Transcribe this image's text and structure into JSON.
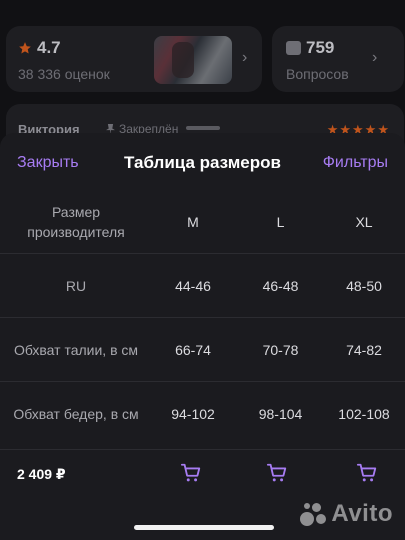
{
  "rating_card": {
    "value": "4.7",
    "reviews": "38 336 оценок"
  },
  "questions_card": {
    "value": "759",
    "label": "Вопросов"
  },
  "review": {
    "author": "Виктория",
    "pinned": "Закреплён",
    "stars": "★★★★★"
  },
  "sheet": {
    "close_label": "Закрыть",
    "title": "Таблица размеров",
    "filters_label": "Фильтры"
  },
  "table": {
    "header": {
      "label": "Размер производителя",
      "s1": "M",
      "s2": "L",
      "s3": "XL"
    },
    "rows": [
      {
        "label": "RU",
        "s1": "44-46",
        "s2": "46-48",
        "s3": "48-50"
      },
      {
        "label": "Обхват талии, в см",
        "s1": "66-74",
        "s2": "70-78",
        "s3": "74-82"
      },
      {
        "label": "Обхват бедер, в см",
        "s1": "94-102",
        "s2": "98-104",
        "s3": "102-108"
      }
    ]
  },
  "price": "2 409 ₽",
  "watermark": "Avito",
  "colors": {
    "accent": "#a77cf2",
    "sheet_bg": "#1b1b1f",
    "star": "#c0541c"
  }
}
